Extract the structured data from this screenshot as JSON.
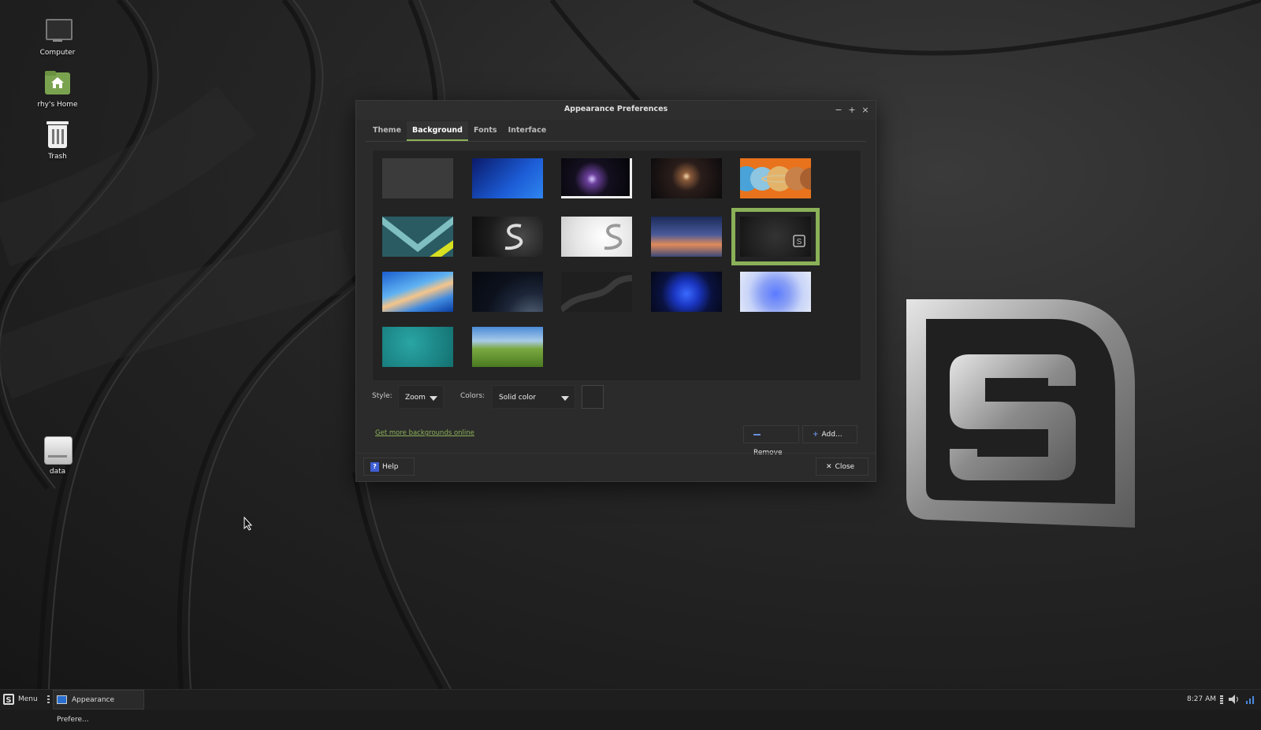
{
  "desktop": {
    "icons": [
      {
        "label": "Computer"
      },
      {
        "label": "rhy's Home"
      },
      {
        "label": "Trash"
      },
      {
        "label": "data"
      }
    ]
  },
  "window": {
    "title": "Appearance Preferences",
    "controls": {
      "minimize": "−",
      "maximize": "+",
      "close": "×"
    },
    "tabs": [
      {
        "label": "Theme",
        "active": false
      },
      {
        "label": "Background",
        "active": true
      },
      {
        "label": "Fonts",
        "active": false
      },
      {
        "label": "Interface",
        "active": false
      }
    ],
    "backgrounds": [
      {
        "name": "solid-gray"
      },
      {
        "name": "blue-gradient"
      },
      {
        "name": "comet"
      },
      {
        "name": "galaxy"
      },
      {
        "name": "planets"
      },
      {
        "name": "teal-chevron"
      },
      {
        "name": "dark-logo-swirl"
      },
      {
        "name": "light-logo-swirl"
      },
      {
        "name": "sunset-lake"
      },
      {
        "name": "dark-logo-badge",
        "selected": true
      },
      {
        "name": "blue-waves"
      },
      {
        "name": "planet-horizon"
      },
      {
        "name": "dark-road"
      },
      {
        "name": "blue-bloom"
      },
      {
        "name": "light-bloom"
      },
      {
        "name": "teal-texture"
      },
      {
        "name": "green-hills"
      }
    ],
    "style_label": "Style:",
    "style_value": "Zoom",
    "colors_label": "Colors:",
    "colors_value": "Solid color",
    "color_swatch": "#262626",
    "link_text": "Get more backgrounds online",
    "remove_label": "Remove",
    "add_label": "Add...",
    "help_label": "Help",
    "close_label": "Close",
    "accent_color": "#8bb158"
  },
  "taskbar": {
    "menu_label": "Menu",
    "task_label": "Appearance Prefere...",
    "clock": "8:27 AM"
  }
}
